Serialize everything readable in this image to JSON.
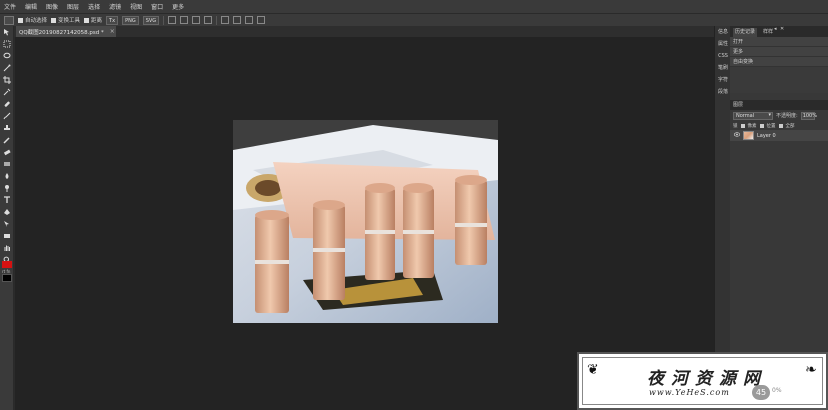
{
  "menu": [
    "文件",
    "编辑",
    "图像",
    "图层",
    "选择",
    "滤镜",
    "视图",
    "窗口",
    "更多"
  ],
  "options": {
    "auto_select": "自动选择",
    "transform_controls": "变换工具",
    "distance": "距离",
    "fmt_dropdown": "Tx",
    "png": "PNG",
    "svg": "SVG"
  },
  "document": {
    "tab_title": "QQ截图20190827142058.psd *",
    "close_glyph": "×"
  },
  "dock": [
    "信息",
    "属性",
    "CSS",
    "笔刷",
    "字符",
    "段落"
  ],
  "panel": {
    "tabs": [
      "历史记录",
      "样样"
    ],
    "collapse_glyph": "◂",
    "close_glyph": "✕",
    "history": [
      "打开",
      "更多",
      "自由变换"
    ]
  },
  "layers": {
    "title": "图层",
    "blend_mode": "Normal",
    "opacity_label": "不透明度:",
    "opacity_value": "100%",
    "lock_label": "锁",
    "lock_opts": [
      "像素",
      "位置",
      "全部"
    ],
    "items": [
      {
        "name": "Layer 0",
        "visible": true
      }
    ]
  },
  "colors": {
    "foreground": "#d41111",
    "background": "#000000"
  },
  "watermark": {
    "title": "夜河资源网",
    "subtitle": "www.YeHeS.com",
    "badge": "45",
    "badge_text": "0%"
  },
  "swatch_label": "rt fn"
}
